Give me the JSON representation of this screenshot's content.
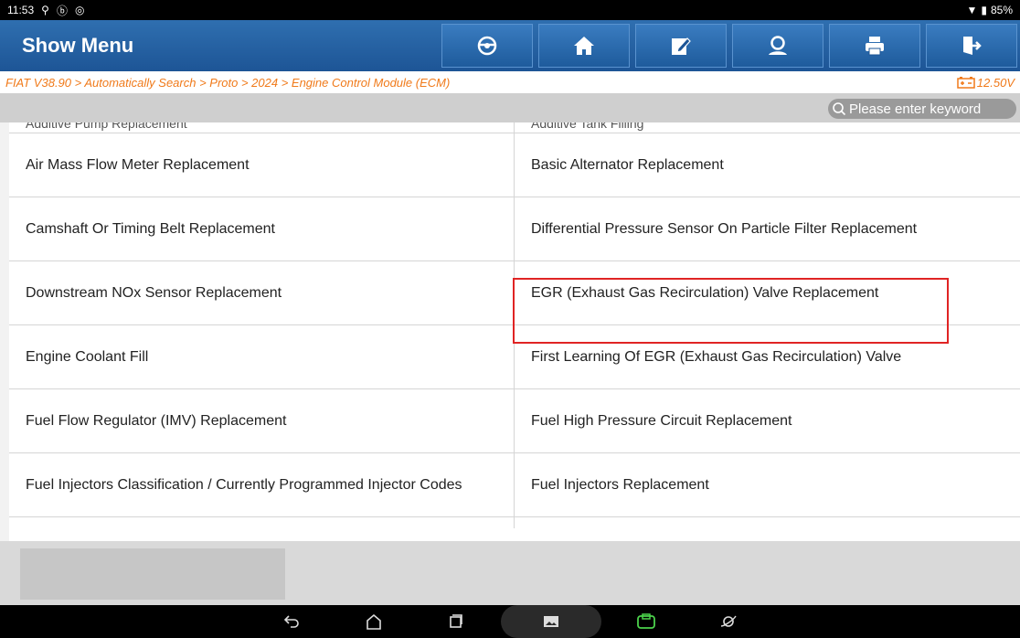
{
  "status": {
    "time": "11:53",
    "battery": "85%"
  },
  "header": {
    "title": "Show Menu",
    "buttons": [
      {
        "icon": "steering-wheel-icon"
      },
      {
        "icon": "home-icon"
      },
      {
        "icon": "edit-icon"
      },
      {
        "icon": "user-support-icon"
      },
      {
        "icon": "print-icon"
      },
      {
        "icon": "exit-icon"
      }
    ]
  },
  "breadcrumb": {
    "path": "FIAT V38.90 > Automatically Search > Proto > 2024 > Engine Control Module (ECM)",
    "voltage": "12.50V"
  },
  "search": {
    "placeholder": "Please enter keyword"
  },
  "menu": {
    "partial": [
      "Additive Pump Replacement",
      "Additive Tank Filling"
    ],
    "rows": [
      [
        "Air Mass Flow Meter Replacement",
        "Basic Alternator Replacement"
      ],
      [
        "Camshaft Or Timing Belt Replacement",
        "Differential Pressure Sensor On Particle Filter Replacement"
      ],
      [
        "Downstream NOx Sensor Replacement",
        "EGR (Exhaust Gas Recirculation) Valve Replacement"
      ],
      [
        "Engine Coolant Fill",
        "First Learning Of EGR (Exhaust Gas Recirculation) Valve"
      ],
      [
        "Fuel Flow Regulator (IMV) Replacement",
        "Fuel High Pressure Circuit Replacement"
      ],
      [
        "Fuel Injectors Classification / Currently Programmed Injector Codes",
        "Fuel Injectors Replacement"
      ]
    ]
  },
  "colors": {
    "header": "#1d5596",
    "breadcrumb": "#f07a1a",
    "highlight": "#e02424"
  }
}
